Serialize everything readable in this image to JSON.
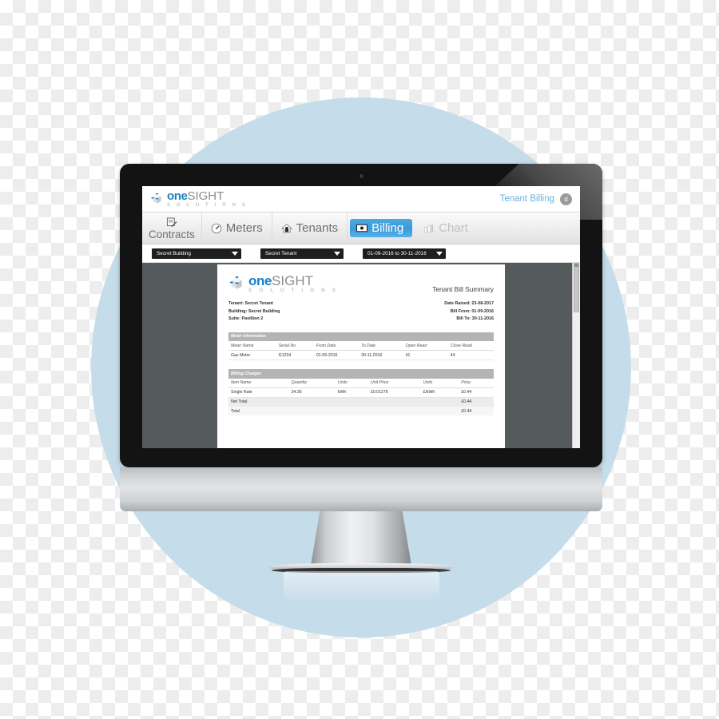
{
  "brand": {
    "one": "one",
    "sight": "SIGHT",
    "solutions": "S O L U T I O N S"
  },
  "header": {
    "context_label": "Tenant Billing",
    "avatar_initial": "d"
  },
  "nav": {
    "tabs": [
      {
        "label": "Contracts",
        "icon": "document-pencil-icon",
        "state": "stacked"
      },
      {
        "label": "Meters",
        "icon": "gauge-icon",
        "state": "normal"
      },
      {
        "label": "Tenants",
        "icon": "house-icon",
        "state": "normal"
      },
      {
        "label": "Billing",
        "icon": "banknote-icon",
        "state": "active"
      },
      {
        "label": "Chart",
        "icon": "bar-chart-icon",
        "state": "muted"
      }
    ]
  },
  "filters": [
    {
      "name": "building",
      "value": "Secret Building"
    },
    {
      "name": "tenant",
      "value": "Secret Tenant"
    },
    {
      "name": "period",
      "value": "01-09-2016 to 30-11-2016"
    }
  ],
  "document": {
    "title": "Tenant Bill Summary",
    "left_meta": [
      "Tenant: Secret Tenant",
      "Building: Secret Building",
      "Suite: Pavillion 2"
    ],
    "right_meta": [
      "Date Raised: 23-08-2017",
      "Bill From: 01-09-2016",
      "Bill To: 30-11-2016"
    ],
    "meter_section": {
      "title": "Meter Information",
      "columns": [
        "Meter Name",
        "Serial No",
        "From Date",
        "To Date",
        "Open Read",
        "Close Read"
      ],
      "rows": [
        [
          "Gas Meter",
          "G1234",
          "01-09-2016",
          "30-11-2016",
          "41",
          "44"
        ]
      ]
    },
    "billing_section": {
      "title": "Billing Charges",
      "columns": [
        "Item Name",
        "Quantity",
        "Units",
        "Unit Price",
        "Units",
        "Price"
      ],
      "rows": [
        [
          "Single Rate",
          "34.36",
          "kWh",
          "£0.01276",
          "£/kWh",
          "£0.44"
        ]
      ],
      "totals": [
        {
          "label": "Net Total",
          "value": "£0.44"
        },
        {
          "label": "Total",
          "value": "£0.44"
        }
      ]
    }
  },
  "colors": {
    "accent_blue": "#3b9ada",
    "link_blue": "#67b2e0",
    "brand_blue": "#1b7fc4",
    "circle_bg": "#c5dcea",
    "viewer_bg": "#555a5d"
  }
}
